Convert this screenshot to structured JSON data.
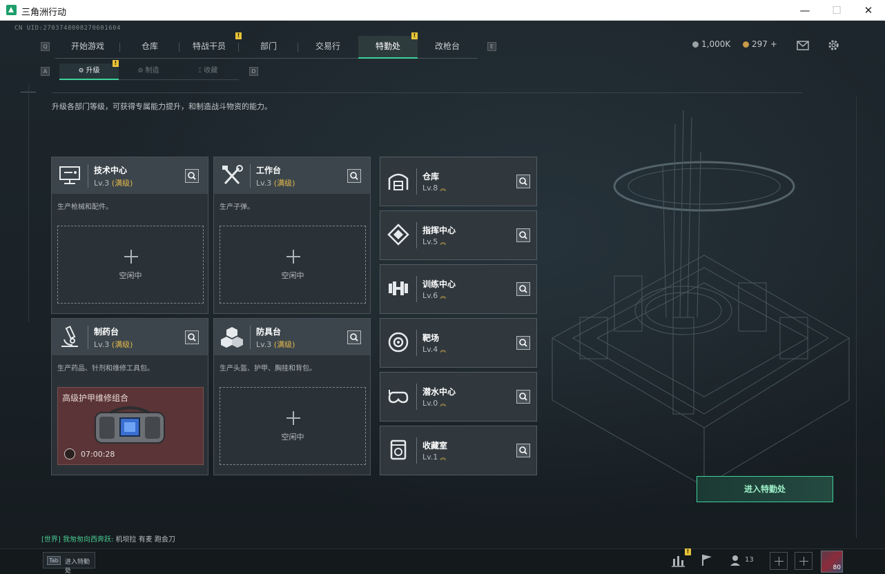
{
  "window": {
    "title": "三角洲行动",
    "min": "—",
    "max": "☐",
    "close": "✕"
  },
  "uid": "CN UID:2703748008270601604",
  "topnav": {
    "left_key": "Q",
    "right_key": "E",
    "tabs": [
      {
        "label": "开始游戏",
        "badge": ""
      },
      {
        "label": "仓库",
        "badge": ""
      },
      {
        "label": "特战干员",
        "badge": "!"
      },
      {
        "label": "部门",
        "badge": ""
      },
      {
        "label": "交易行",
        "badge": ""
      },
      {
        "label": "特勤处",
        "badge": "!",
        "active": true
      },
      {
        "label": "改枪台",
        "badge": ""
      }
    ]
  },
  "currency": {
    "coins": "1,000K",
    "gems": "297 +"
  },
  "subnav": {
    "left_key": "A",
    "right_key": "D",
    "tabs": [
      {
        "label": "升级",
        "badge": "!",
        "active": true
      },
      {
        "label": "制造"
      },
      {
        "label": "收藏"
      }
    ]
  },
  "description": "升级各部门等级，可获得专属能力提升，和制造战斗物资的能力。",
  "cards": [
    {
      "name": "技术中心",
      "level": "Lv.3",
      "max": "(满级)",
      "desc": "生产枪械和配件。",
      "idle_text": "空闲中",
      "icon": "computer-icon"
    },
    {
      "name": "工作台",
      "level": "Lv.3",
      "max": "(满级)",
      "desc": "生产子弹。",
      "idle_text": "空闲中",
      "icon": "tools-icon"
    },
    {
      "name": "制药台",
      "level": "Lv.3",
      "max": "(满级)",
      "desc": "生产药品、针剂和维修工具包。",
      "craft_title": "高级护甲维修组合",
      "craft_timer": "07:00:28",
      "icon": "microscope-icon"
    },
    {
      "name": "防具台",
      "level": "Lv.3",
      "max": "(满级)",
      "desc": "生产头盔、护甲、胸挂和背包。",
      "idle_text": "空闲中",
      "icon": "armor-boxes-icon"
    }
  ],
  "facilities": [
    {
      "name": "仓库",
      "level": "Lv.8",
      "up": "︽",
      "icon": "warehouse-icon"
    },
    {
      "name": "指挥中心",
      "level": "Lv.5",
      "up": "︽",
      "icon": "command-icon"
    },
    {
      "name": "训练中心",
      "level": "Lv.6",
      "up": "︽",
      "icon": "dumbbell-icon"
    },
    {
      "name": "靶场",
      "level": "Lv.4",
      "up": "︽",
      "icon": "target-icon"
    },
    {
      "name": "潜水中心",
      "level": "Lv.0",
      "up": "︽",
      "icon": "goggles-icon"
    },
    {
      "name": "收藏室",
      "level": "Lv.1",
      "up": "︽",
      "icon": "collection-icon"
    }
  ],
  "enter_button": "进入特勤处",
  "chat": {
    "channel": "[世界] 我匆匆向西奔跃:",
    "message": " 机坝拉 有麦 跑会刀"
  },
  "bottombar": {
    "tab_key": "Tab",
    "tab_label": "进入特勤处",
    "stats_badge": "!",
    "friends_count": "13",
    "level": "80"
  },
  "colors": {
    "accent": "#3dd39a",
    "max_level": "#e2b84c",
    "badge": "#e8c33a"
  }
}
